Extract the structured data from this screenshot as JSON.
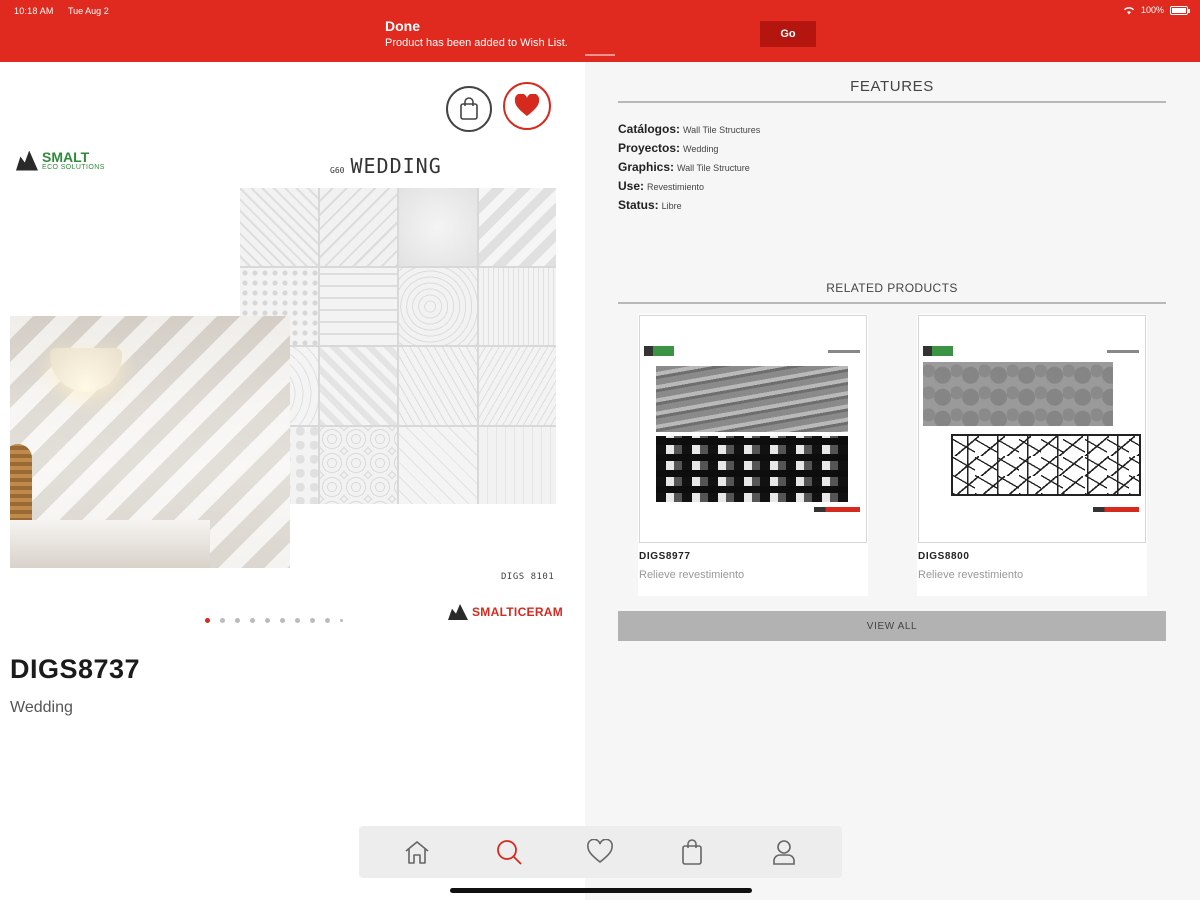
{
  "status_bar": {
    "time": "10:18 AM",
    "date": "Tue Aug 2",
    "battery": "100%"
  },
  "notification": {
    "title": "Done",
    "message": "Product has been added to Wish List.",
    "action_label": "Go"
  },
  "product": {
    "code": "DIGS8737",
    "name": "Wedding",
    "image": {
      "logo_top_text": "SMALT",
      "logo_top_sub": "ECO SOLUTIONS",
      "collection_code": "G60",
      "collection_name": "WEDDING",
      "tile_code": "DIGS 8101",
      "brand": "SMALTICERAM"
    },
    "carousel": {
      "total": 10,
      "active_index": 0
    }
  },
  "features": {
    "heading": "FEATURES",
    "items": [
      {
        "key": "Catálogos:",
        "value": "Wall Tile Structures"
      },
      {
        "key": "Proyectos:",
        "value": "Wedding"
      },
      {
        "key": "Graphics:",
        "value": "Wall Tile Structure"
      },
      {
        "key": "Use:",
        "value": "Revestimiento"
      },
      {
        "key": "Status:",
        "value": "Libre"
      }
    ]
  },
  "related": {
    "heading": "RELATED PRODUCTS",
    "items": [
      {
        "code": "DIGS8977",
        "description": "Relieve revestimiento"
      },
      {
        "code": "DIGS8800",
        "description": "Relieve revestimiento"
      }
    ],
    "view_all_label": "VIEW ALL"
  },
  "tabbar": {
    "tabs": [
      {
        "name": "home-icon",
        "active": false
      },
      {
        "name": "search-icon",
        "active": true
      },
      {
        "name": "heart-icon",
        "active": false
      },
      {
        "name": "shopping-bag-icon",
        "active": false
      },
      {
        "name": "user-icon",
        "active": false
      }
    ]
  },
  "colors": {
    "brand_red": "#e0291f",
    "go_button": "#b4150f",
    "active_tab": "#d72a1f",
    "tab_icon": "#666666"
  }
}
